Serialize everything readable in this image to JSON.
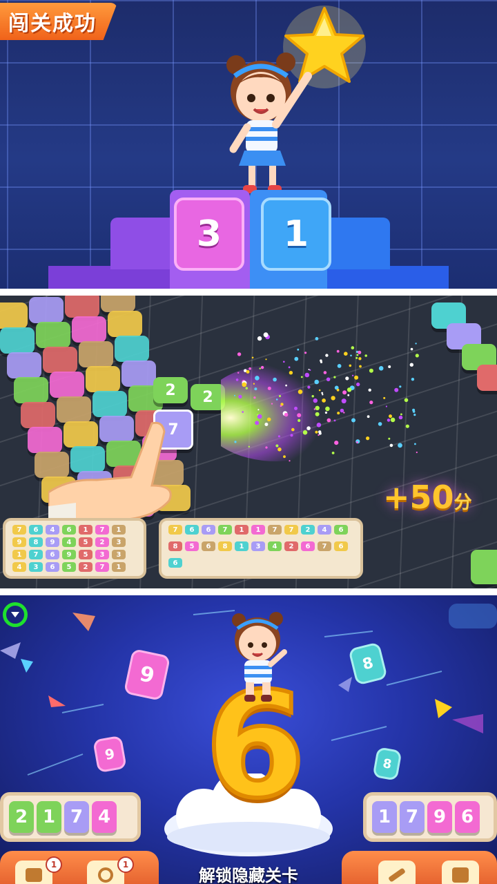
{
  "panel1": {
    "banner_text": "闯关成功",
    "podium_left_number": "3",
    "podium_right_number": "1"
  },
  "panel2": {
    "board_front_tiles": [
      "2",
      "2",
      "7"
    ],
    "score_popup": "+50",
    "score_unit": "分",
    "left_tray_tiles": [
      "7",
      "6",
      "4",
      "6",
      "1",
      "7",
      "1",
      "9",
      "8",
      "9",
      "4",
      "5",
      "2",
      "3",
      "1",
      "7",
      "6",
      "9",
      "5",
      "3",
      "3",
      "4",
      "3",
      "6",
      "5",
      "2",
      "7",
      "1"
    ],
    "right_tray_tiles": [
      "7",
      "6",
      "6",
      "7",
      "1",
      "1",
      "7",
      "7",
      "2",
      "4",
      "6",
      "8",
      "5",
      "6",
      "8",
      "1",
      "3",
      "4",
      "2",
      "6",
      "7",
      "6",
      "6"
    ]
  },
  "panel3": {
    "big_number": "6",
    "floating_tiles": [
      "9",
      "8",
      "9",
      "8"
    ],
    "left_tray_tiles": [
      "2",
      "1",
      "7",
      "4"
    ],
    "right_tray_tiles": [
      "1",
      "7",
      "9",
      "6"
    ],
    "unlock_text": "解锁隐藏关卡",
    "left_tool_badges": [
      "1",
      "1"
    ]
  },
  "colors": {
    "orange_banner": "#f37a28",
    "pink_tile": "#e75ad8",
    "blue_tile": "#3b9ff2",
    "yellow_six": "#ffc21a",
    "score_gold": "#ffc52d"
  },
  "icons": [
    "star-icon",
    "hand-pointer-icon",
    "sparkle-burst-icon",
    "cloud-icon",
    "tool-icon"
  ]
}
